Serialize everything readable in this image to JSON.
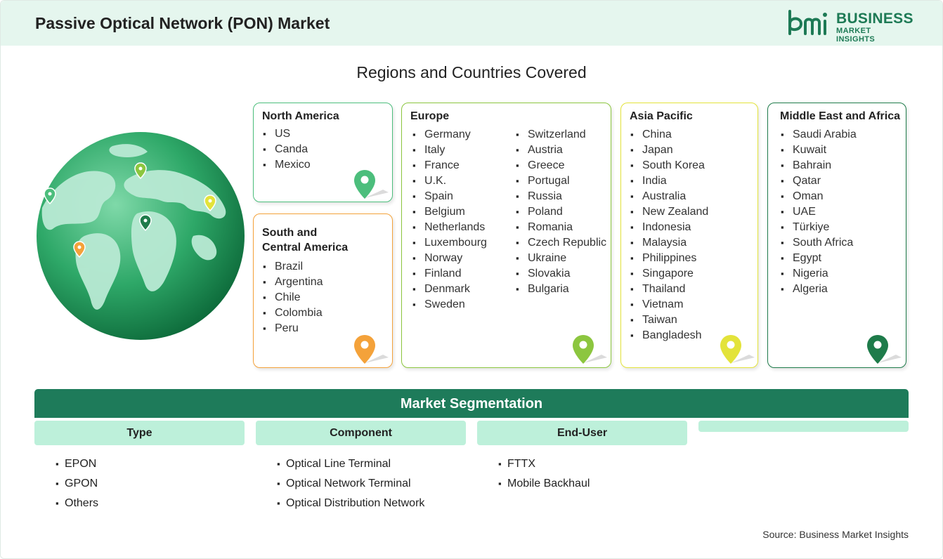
{
  "header": {
    "title": "Passive Optical Network (PON) Market",
    "logo_line1": "BUSINESS",
    "logo_line2": "MARKET INSIGHTS",
    "logo_mark_text": "bmi"
  },
  "regions_title": "Regions and Countries Covered",
  "regions": {
    "north_america": {
      "title": "North America",
      "countries": [
        "US",
        "Canda",
        "Mexico"
      ],
      "color": "#4cbe7c"
    },
    "south_central_america": {
      "title_line1": "South and",
      "title_line2": "Central America",
      "countries": [
        "Brazil",
        "Argentina",
        "Chile",
        "Colombia",
        "Peru"
      ],
      "color": "#f4a23a"
    },
    "europe": {
      "title": "Europe",
      "countries_col1": [
        "Germany",
        "Italy",
        "France",
        "U.K.",
        "Spain",
        "Belgium",
        "Netherlands",
        "Luxembourg",
        "Norway",
        "Finland",
        "Denmark",
        "Sweden"
      ],
      "countries_col2": [
        "Switzerland",
        "Austria",
        "Greece",
        "Portugal",
        "Russia",
        "Poland",
        "Romania",
        "Czech Republic",
        "Ukraine",
        "Slovakia",
        "Bulgaria"
      ],
      "color": "#8cc63f"
    },
    "asia_pacific": {
      "title": "Asia Pacific",
      "countries": [
        "China",
        "Japan",
        "South Korea",
        "India",
        "Australia",
        "New Zealand",
        "Indonesia",
        "Malaysia",
        "Philippines",
        "Singapore",
        "Thailand",
        "Vietnam",
        "Taiwan",
        "Bangladesh"
      ],
      "color": "#e3e33a"
    },
    "middle_east_africa": {
      "title": "Middle East and Africa",
      "countries": [
        "Saudi Arabia",
        "Kuwait",
        "Bahrain",
        "Qatar",
        "Oman",
        "UAE",
        "Türkiye",
        "South Africa",
        "Egypt",
        "Nigeria",
        "Algeria"
      ],
      "color": "#1e7b4a"
    }
  },
  "segmentation": {
    "title": "Market Segmentation",
    "columns": [
      {
        "header": "Type",
        "items": [
          "EPON",
          "GPON",
          "Others"
        ]
      },
      {
        "header": "Component",
        "items": [
          "Optical Line Terminal",
          "Optical Network Terminal",
          "Optical Distribution Network"
        ]
      },
      {
        "header": "End-User",
        "items": [
          "FTTX",
          "Mobile Backhaul"
        ]
      }
    ]
  },
  "source": "Source: Business Market Insights",
  "colors": {
    "header_bg": "#e5f6ee",
    "brand_green": "#1e7b5a",
    "segment_header_bg": "#bdf0da"
  },
  "icons": [
    "location-pin-icon",
    "globe-illustration",
    "bmi-logo"
  ]
}
